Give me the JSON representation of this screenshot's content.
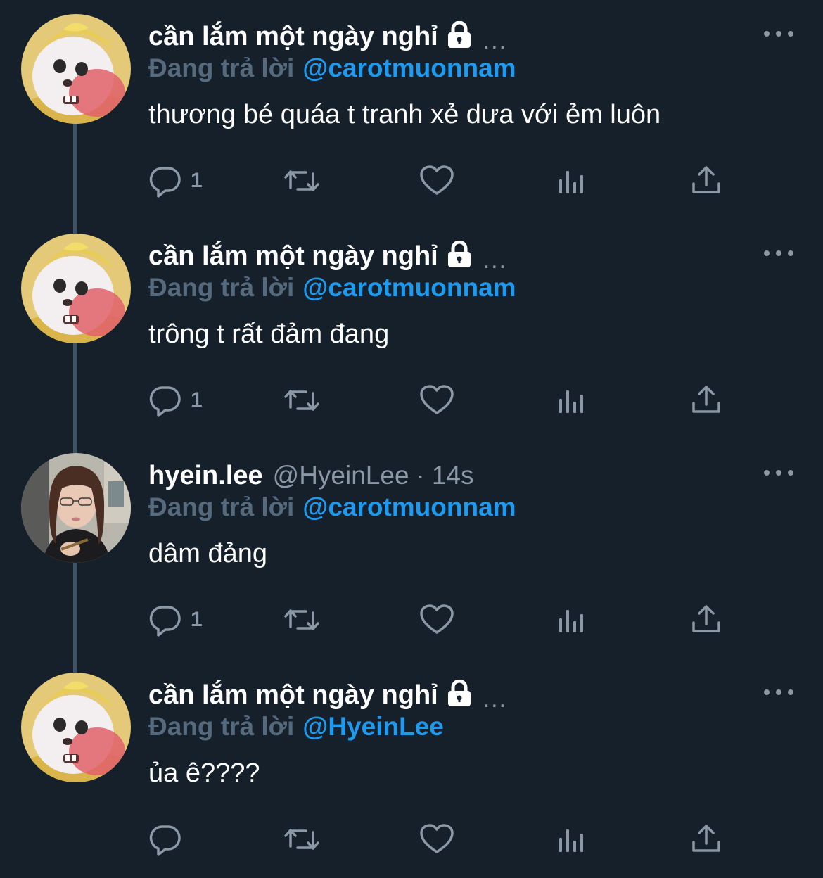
{
  "theme": {
    "background": "#15202b",
    "text": "#ffffff",
    "muted": "#8b98a5",
    "reply_prefix": "#556a7c",
    "link": "#1d9bf0",
    "thread_line": "#3d5466"
  },
  "tweets": [
    {
      "author_name": "cần lắm một ngày nghỉ",
      "protected_icon": "lock-icon",
      "header_overflow": "...",
      "replying_prefix": "Đang trả lời",
      "replying_to": "@carotmuonnam",
      "text": "thương bé quáa t tranh xẻ dưa với ẻm luôn",
      "reply_count": "1",
      "avatar": "yellow-hat-character-avatar"
    },
    {
      "author_name": "cần lắm một ngày nghỉ",
      "protected_icon": "lock-icon",
      "header_overflow": "...",
      "replying_prefix": "Đang trả lời",
      "replying_to": "@carotmuonnam",
      "text": "trông t rất đảm đang",
      "reply_count": "1",
      "avatar": "yellow-hat-character-avatar"
    },
    {
      "author_name": "hyein.lee",
      "handle": "@HyeinLee",
      "separator": "·",
      "time": "14s",
      "replying_prefix": "Đang trả lời",
      "replying_to": "@carotmuonnam",
      "text": "dâm đảng",
      "reply_count": "1",
      "avatar": "girl-photo-avatar"
    },
    {
      "author_name": "cần lắm một ngày nghỉ",
      "protected_icon": "lock-icon",
      "header_overflow": "...",
      "replying_prefix": "Đang trả lời",
      "replying_to": "@HyeinLee",
      "text": "ủa ê????",
      "reply_count": "",
      "avatar": "yellow-hat-character-avatar"
    }
  ],
  "action_icons": [
    "reply-icon",
    "retweet-icon",
    "like-icon",
    "views-icon",
    "share-icon"
  ]
}
